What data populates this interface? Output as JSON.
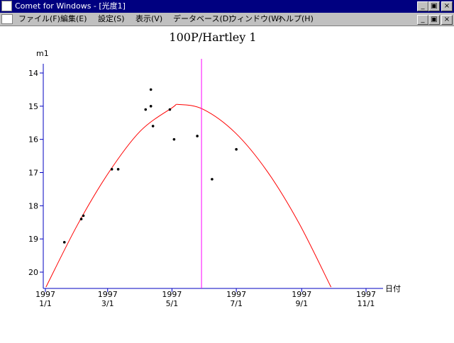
{
  "window": {
    "title": "Comet for Windows - [光度1]",
    "controls": [
      "_",
      "▣",
      "×"
    ]
  },
  "menu": {
    "items": [
      "ファイル(F)",
      "編集(E)",
      "設定(S)",
      "表示(V)",
      "データベース(D)",
      "ウィンドウ(W)",
      "ヘルプ(H)"
    ],
    "mdi_controls": [
      "_",
      "▣",
      "×"
    ]
  },
  "chart_data": {
    "type": "scatter",
    "title": "100P/Hartley 1",
    "xlabel": "日付",
    "ylabel": "m1",
    "x_ticks": [
      {
        "date": "1997-01-01",
        "year": "1997",
        "label": "1/1"
      },
      {
        "date": "1997-03-01",
        "year": "1997",
        "label": "3/1"
      },
      {
        "date": "1997-05-01",
        "year": "1997",
        "label": "5/1"
      },
      {
        "date": "1997-07-01",
        "year": "1997",
        "label": "7/1"
      },
      {
        "date": "1997-09-01",
        "year": "1997",
        "label": "9/1"
      },
      {
        "date": "1997-11-01",
        "year": "1997",
        "label": "11/1"
      }
    ],
    "xlim": [
      "1997-01-01",
      "1997-11-20"
    ],
    "y_ticks": [
      14,
      15,
      16,
      17,
      18,
      19,
      20
    ],
    "ylim": [
      13.6,
      20.45
    ],
    "y_inverted": true,
    "series": [
      {
        "kind": "points",
        "color": "#000000",
        "points": [
          {
            "date": "1997-01-19",
            "m": 19.1
          },
          {
            "date": "1997-02-04",
            "m": 18.4
          },
          {
            "date": "1997-02-06",
            "m": 18.3
          },
          {
            "date": "1997-03-05",
            "m": 16.9
          },
          {
            "date": "1997-03-11",
            "m": 16.9
          },
          {
            "date": "1997-04-06",
            "m": 15.1
          },
          {
            "date": "1997-04-11",
            "m": 14.5
          },
          {
            "date": "1997-04-11",
            "m": 15.0
          },
          {
            "date": "1997-04-13",
            "m": 15.6
          },
          {
            "date": "1997-04-29",
            "m": 15.1
          },
          {
            "date": "1997-05-03",
            "m": 16.0
          },
          {
            "date": "1997-05-25",
            "m": 15.9
          },
          {
            "date": "1997-06-08",
            "m": 17.2
          },
          {
            "date": "1997-07-01",
            "m": 16.3
          }
        ]
      },
      {
        "kind": "curve",
        "color": "#ff0000",
        "points": [
          {
            "date": "1996-12-31",
            "m": 20.55
          },
          {
            "date": "1997-01-31",
            "m": 18.6
          },
          {
            "date": "1997-03-02",
            "m": 17.0
          },
          {
            "date": "1997-04-01",
            "m": 15.75
          },
          {
            "date": "1997-05-01",
            "m": 15.05
          },
          {
            "date": "1997-05-08",
            "m": 14.95
          },
          {
            "date": "1997-05-31",
            "m": 15.1
          },
          {
            "date": "1997-06-30",
            "m": 15.8
          },
          {
            "date": "1997-07-30",
            "m": 16.95
          },
          {
            "date": "1997-08-29",
            "m": 18.5
          },
          {
            "date": "1997-09-28",
            "m": 20.4
          },
          {
            "date": "1997-10-01",
            "m": 20.6
          }
        ]
      }
    ],
    "marker_line": {
      "date": "1997-05-29",
      "color": "#ff00ff"
    },
    "axis_color": "#0000c0",
    "grid": false
  }
}
